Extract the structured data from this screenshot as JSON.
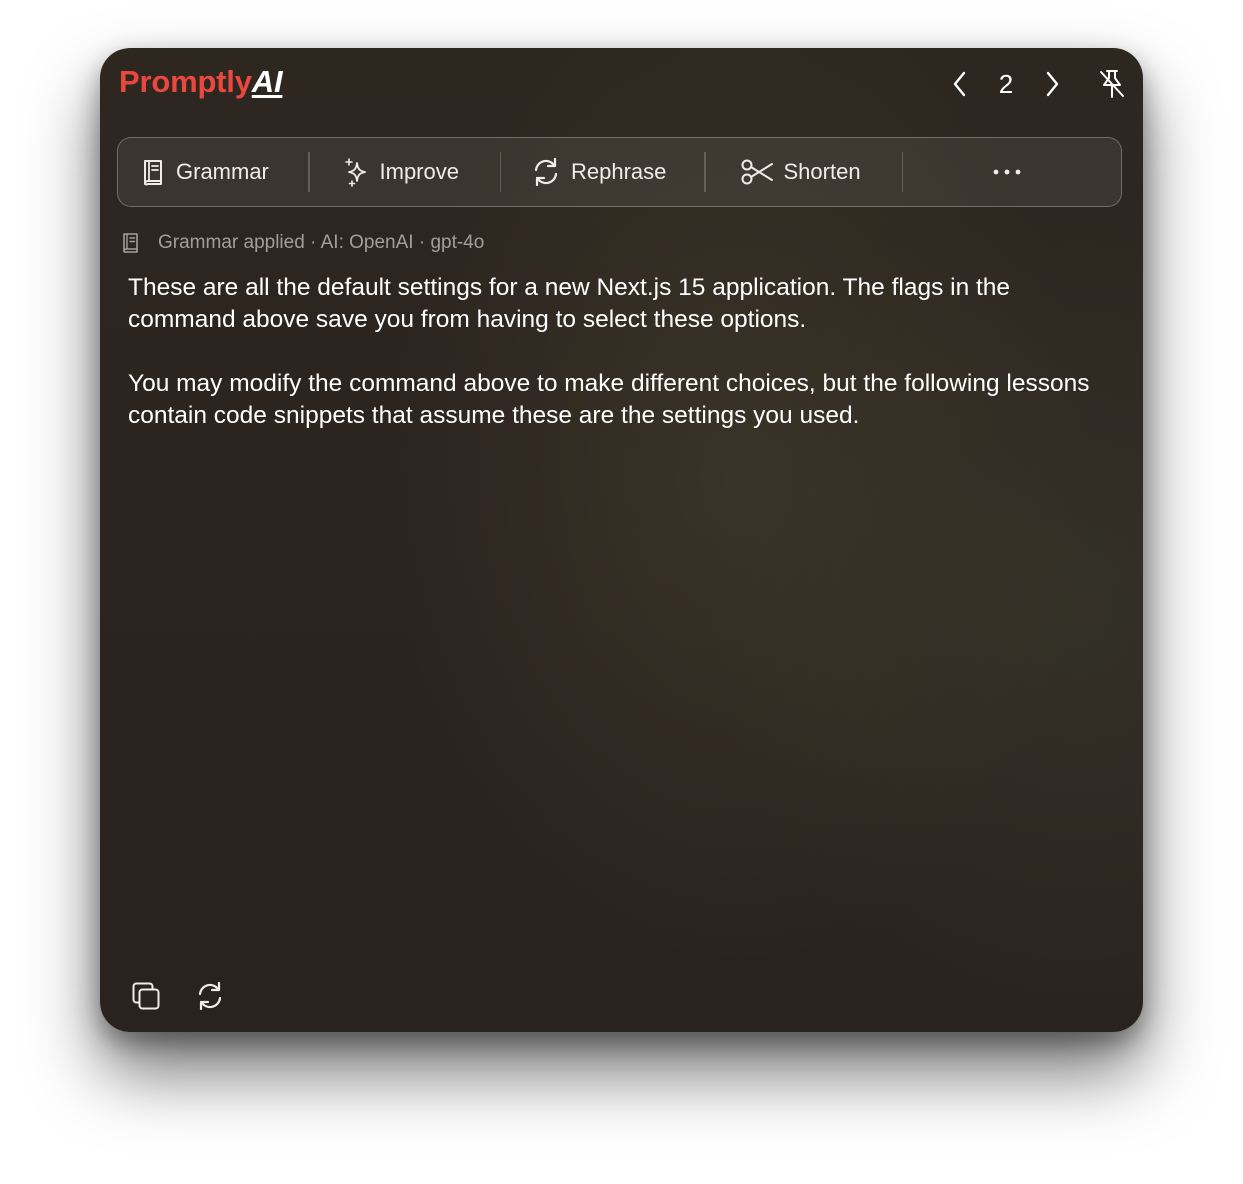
{
  "app": {
    "brand_prefix": "Promptly",
    "brand_suffix": "AI"
  },
  "nav": {
    "page": "2",
    "prev_icon": "chevron-left-icon",
    "next_icon": "chevron-right-icon",
    "pin_icon": "pin-off-icon"
  },
  "toolbar": {
    "items": [
      {
        "label": "Grammar",
        "icon": "book-icon"
      },
      {
        "label": "Improve",
        "icon": "sparkle-icon"
      },
      {
        "label": "Rephrase",
        "icon": "refresh-icon"
      },
      {
        "label": "Shorten",
        "icon": "scissors-icon"
      }
    ],
    "more_label": "···"
  },
  "status": {
    "text": "Grammar applied · AI: OpenAI · gpt-4o",
    "icon": "book-icon"
  },
  "content": {
    "paragraphs": [
      "These are all the default settings for a new Next.js 15 application. The flags in the command above save you from having to select these options.",
      "You may modify the command above to make different choices, but the following lessons contain code snippets that assume these are the settings you used."
    ]
  },
  "footer": {
    "copy_icon": "copy-icon",
    "regenerate_icon": "refresh-icon"
  },
  "colors": {
    "brand": "#e8483e",
    "text": "#ffffff",
    "muted": "#a49e98"
  }
}
